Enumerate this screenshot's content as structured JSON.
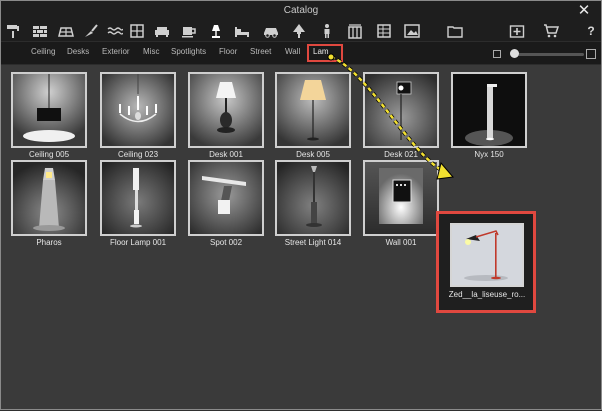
{
  "window": {
    "title": "Catalog",
    "close_glyph": "✕"
  },
  "toolbar": {
    "left_icons": [
      "roller-icon",
      "wall-icon",
      "floor-icon",
      "trowel-icon",
      "water-icon",
      "window-icon",
      "sofa-icon",
      "cup-icon",
      "lamp-icon",
      "bed-icon",
      "car-icon",
      "tree-icon",
      "person-icon",
      "building-icon",
      "table-icon",
      "image-icon"
    ],
    "right_icons": [
      "folder-icon",
      "add-icon",
      "cart-icon",
      "help-icon"
    ],
    "help_label": "?"
  },
  "tabs": [
    "Ceiling",
    "Desks",
    "Exterior",
    "Misc",
    "Spotlights",
    "Floor",
    "Street",
    "Wall",
    "Lamps"
  ],
  "active_tab": "Lamps",
  "tab_visible_text": "Lam",
  "size_slider": {
    "value": 0.05
  },
  "items": [
    {
      "label": "Ceiling 005"
    },
    {
      "label": "Ceiling 023"
    },
    {
      "label": "Desk 001"
    },
    {
      "label": "Desk 005"
    },
    {
      "label": "Desk 021"
    },
    {
      "label": "Nyx 150"
    },
    {
      "label": "Pharos"
    },
    {
      "label": "Floor Lamp 001"
    },
    {
      "label": "Spot 002"
    },
    {
      "label": "Street Light 014"
    },
    {
      "label": "Wall 001"
    }
  ],
  "dragged_item": {
    "label": "Zed__la_liseuse_ro..."
  },
  "colors": {
    "highlight": "#e0483f",
    "arrow": "#f2e030"
  }
}
